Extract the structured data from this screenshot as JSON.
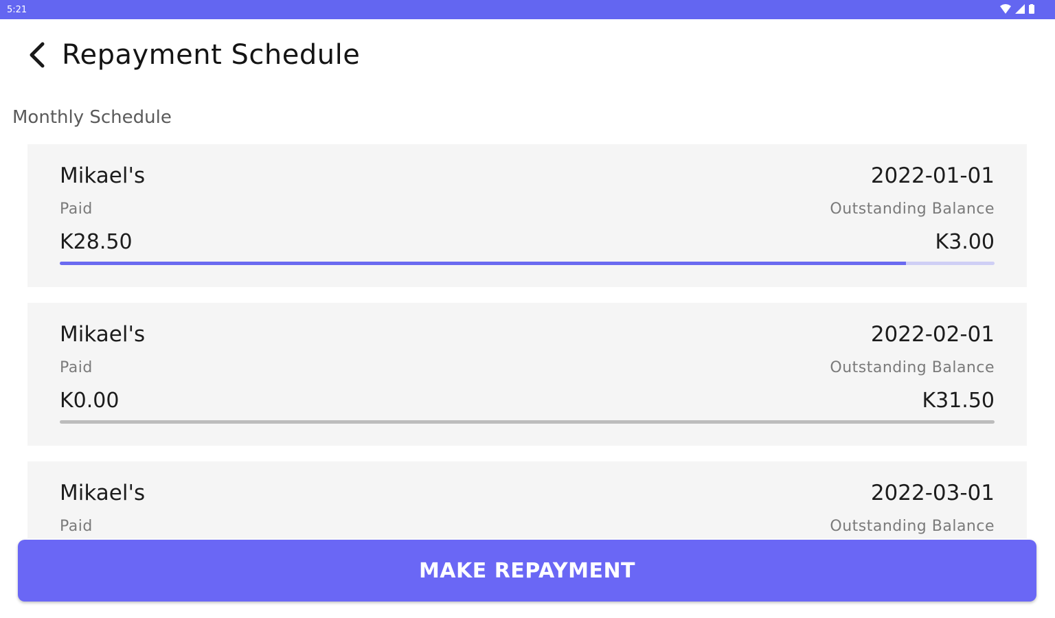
{
  "status_bar": {
    "time": "5:21",
    "color": "#6366f1"
  },
  "header": {
    "back_icon": "chevron-left-icon",
    "title": "Repayment Schedule"
  },
  "section_label": "Monthly Schedule",
  "schedule": [
    {
      "name": "Mikael's",
      "date": "2022-01-01",
      "paid_label": "Paid",
      "balance_label": "Outstanding Balance",
      "paid": "K28.50",
      "balance": "K3.00",
      "progress_pct": 90.5
    },
    {
      "name": "Mikael's",
      "date": "2022-02-01",
      "paid_label": "Paid",
      "balance_label": "Outstanding Balance",
      "paid": "K0.00",
      "balance": "K31.50",
      "progress_pct": 0
    },
    {
      "name": "Mikael's",
      "date": "2022-03-01",
      "paid_label": "Paid",
      "balance_label": "Outstanding Balance"
    }
  ],
  "cta": {
    "label": "MAKE REPAYMENT",
    "color": "#6a67f5"
  }
}
